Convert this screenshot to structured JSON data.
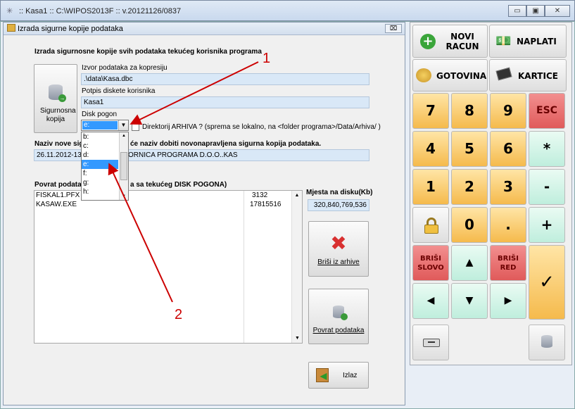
{
  "window": {
    "title": ":: Kasa1 :: C:\\WIPOS2013F :: v.20121126/0837",
    "btn_min": "▭",
    "btn_max": "▣",
    "btn_close": "✕"
  },
  "dialog": {
    "title": "Izrada sigurne kopije podataka",
    "close_label": "⌧",
    "heading": "Izrada sigurnosne kopije svih podataka tekućeg korisnika programa",
    "backup_button_label": "Sigurnosna kopija",
    "source_label": "Izvor podataka za kopresiju",
    "source_value": ".\\data\\Kasa.dbc",
    "disk_sig_label": "Potpis diskete korisnika",
    "disk_sig_value": "Kasa1",
    "drive_label": "Disk pogon",
    "drive_value": "e:",
    "drive_options": [
      "b:",
      "c:",
      "d:",
      "e:",
      "f:",
      "g:",
      "h:"
    ],
    "archive_checkbox_label": "Direktorij ARHIVA ? (sprema se lokalno, na <folder programa>/Data/Arhiva/ )",
    "name_label_left": "Naziv nove sigu",
    "name_label_right": "će naziv dobiti novonapravljena sigurna kopija podataka.",
    "name_value_left": "26.11.2012-13",
    "name_value_right": "ORNICA PROGRAMA D.O.O..KAS",
    "restore_label_left": "Povrat podatak",
    "restore_label_right": "a sa tekućeg DISK POGONA)",
    "files": [
      {
        "name": "FISKAL1.PFX",
        "size": "3132"
      },
      {
        "name": "KASAW.EXE",
        "size": "17815516"
      }
    ],
    "free_space_label": "Mjesta na disku(Kb)",
    "free_space_value": "320,840,769,536",
    "delete_button_label": "Briši iz arhive",
    "restore_button_label": "Povrat podataka",
    "exit_button_label": "Izlaz",
    "annotation_1": "1",
    "annotation_2": "2"
  },
  "keypad": {
    "new_bill": "NOVI RACUN",
    "pay": "NAPLATI",
    "cash": "GOTOVINA",
    "cards": "KARTICE",
    "k7": "7",
    "k8": "8",
    "k9": "9",
    "esc": "ESC",
    "k4": "4",
    "k5": "5",
    "k6": "6",
    "mul": "*",
    "k1": "1",
    "k2": "2",
    "k3": "3",
    "minus": "-",
    "k0": "0",
    "dot": ".",
    "plus": "+",
    "del_char": "BRIŠI SLOVO",
    "del_row": "BRIŠI RED",
    "ok": "✓"
  },
  "colors": {
    "orange_key": "#f5ba4c",
    "green_key": "#bfeedd",
    "red_key": "#e05a5a",
    "field_bg": "#d9e8f7",
    "selection": "#3399ff",
    "arrow": "#cc0000"
  }
}
